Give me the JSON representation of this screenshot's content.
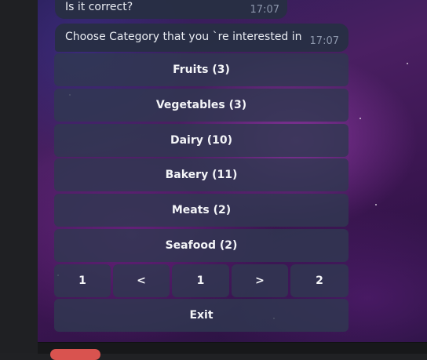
{
  "messages": [
    {
      "text": "Is it correct?",
      "time": "17:07"
    },
    {
      "text": "Choose Category that you `re interested in",
      "time": "17:07"
    }
  ],
  "keyboard": {
    "categories": [
      {
        "label": "Fruits (3)"
      },
      {
        "label": "Vegetables (3)"
      },
      {
        "label": "Dairy (10)"
      },
      {
        "label": "Bakery (11)"
      },
      {
        "label": "Meats (2)"
      },
      {
        "label": "Seafood (2)"
      }
    ],
    "pagination": {
      "first": "1",
      "prev": "<",
      "current": "1",
      "next": ">",
      "last": "2"
    },
    "exit_label": "Exit"
  }
}
